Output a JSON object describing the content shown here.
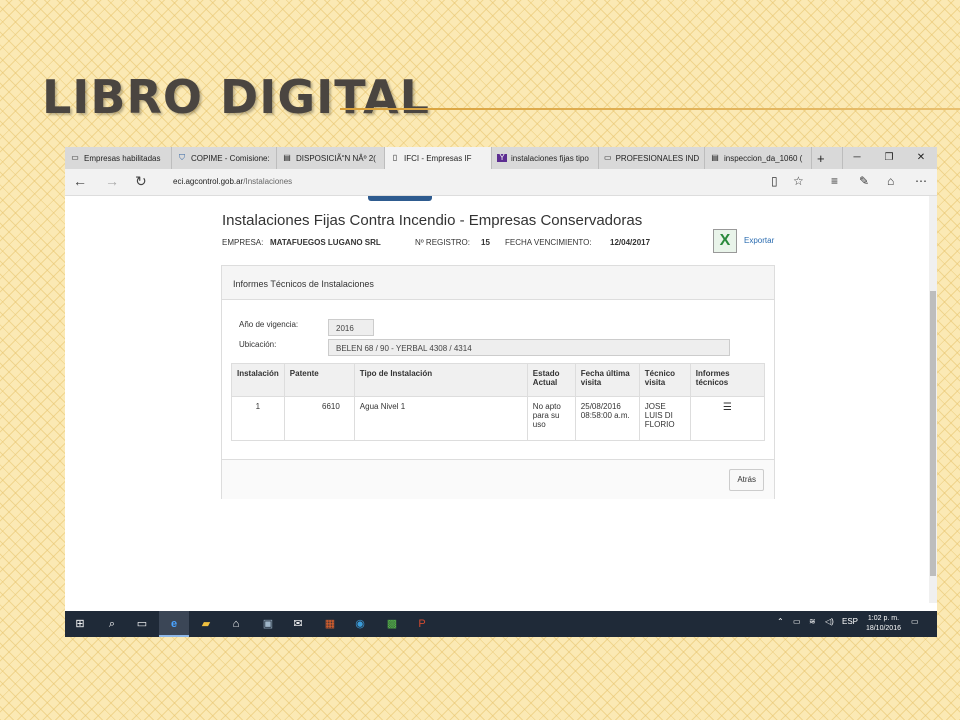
{
  "slide": {
    "title": "LIBRO DIGITAL"
  },
  "browser": {
    "tabs": [
      {
        "label": "Empresas habilitadas",
        "icon": "page-icon"
      },
      {
        "label": "COPIME - Comisione:",
        "icon": "shield-icon"
      },
      {
        "label": "DISPOSICIÃ“N NÂº 2(",
        "icon": "page-icon"
      },
      {
        "label": "IFCI - Empresas IF",
        "icon": "page-icon",
        "active": true
      },
      {
        "label": "instalaciones fijas tipo",
        "icon": "yahoo-icon"
      },
      {
        "label": "PROFESIONALES IND",
        "icon": "page-icon"
      },
      {
        "label": "inspeccion_da_1060 (",
        "icon": "page-icon"
      }
    ],
    "new_tab": "+",
    "url_domain": "eci.agcontrol.gob.ar",
    "url_path": "/Instalaciones"
  },
  "page": {
    "title": "Instalaciones Fijas Contra Incendio - Empresas Conservadoras",
    "empresa_label": "EMPRESA:",
    "empresa_value": "MATAFUEGOS LUGANO SRL",
    "registro_label": "Nº REGISTRO:",
    "registro_value": "15",
    "vencimiento_label": "FECHA VENCIMIENTO:",
    "vencimiento_value": "12/04/2017",
    "export_label": "Exportar",
    "panel_title": "Informes Técnicos de Instalaciones",
    "anio_label": "Año de vigencia:",
    "anio_value": "2016",
    "ubicacion_label": "Ubicación:",
    "ubicacion_value": "BELEN 68 / 90 - YERBAL 4308 / 4314",
    "table": {
      "headers": [
        "Instalación",
        "Patente",
        "Tipo de Instalación",
        "Estado Actual",
        "Fecha última visita",
        "Técnico visita",
        "Informes técnicos"
      ],
      "rows": [
        {
          "instalacion": "1",
          "patente": "6610",
          "tipo": "Agua Nivel 1",
          "estado": "No apto para su uso",
          "fecha": "25/08/2016 08:58:00 a.m.",
          "tecnico": "JOSE LUIS DI FLORIO"
        }
      ]
    },
    "atras_label": "Atrás"
  },
  "taskbar": {
    "lang": "ESP",
    "time": "1:02 p. m.",
    "date": "18/10/2016"
  }
}
